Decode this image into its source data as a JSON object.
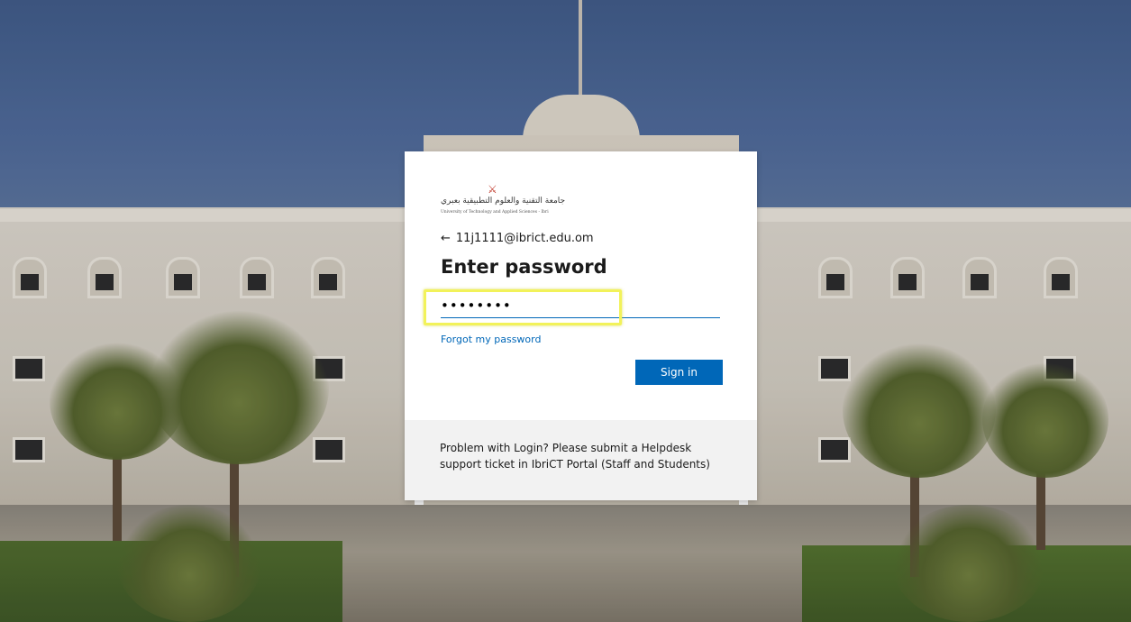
{
  "login": {
    "logo": {
      "arabic_text": "جامعة التقنية والعلوم التطبيقية بعبري",
      "english_text": "University of Technology and Applied Sciences - Ibri",
      "mark": "⚔"
    },
    "identity_email": "11j1111@ibrict.edu.om",
    "back_arrow": "←",
    "title": "Enter password",
    "password_value": "••••••••",
    "forgot_link": "Forgot my password",
    "signin_label": "Sign in",
    "footer_text": "Problem with Login? Please submit a Helpdesk support ticket in IbriCT Portal (Staff and Students)"
  },
  "colors": {
    "accent": "#0067b8",
    "highlight": "#f2f25a",
    "footer_bg": "#f2f2f2"
  }
}
